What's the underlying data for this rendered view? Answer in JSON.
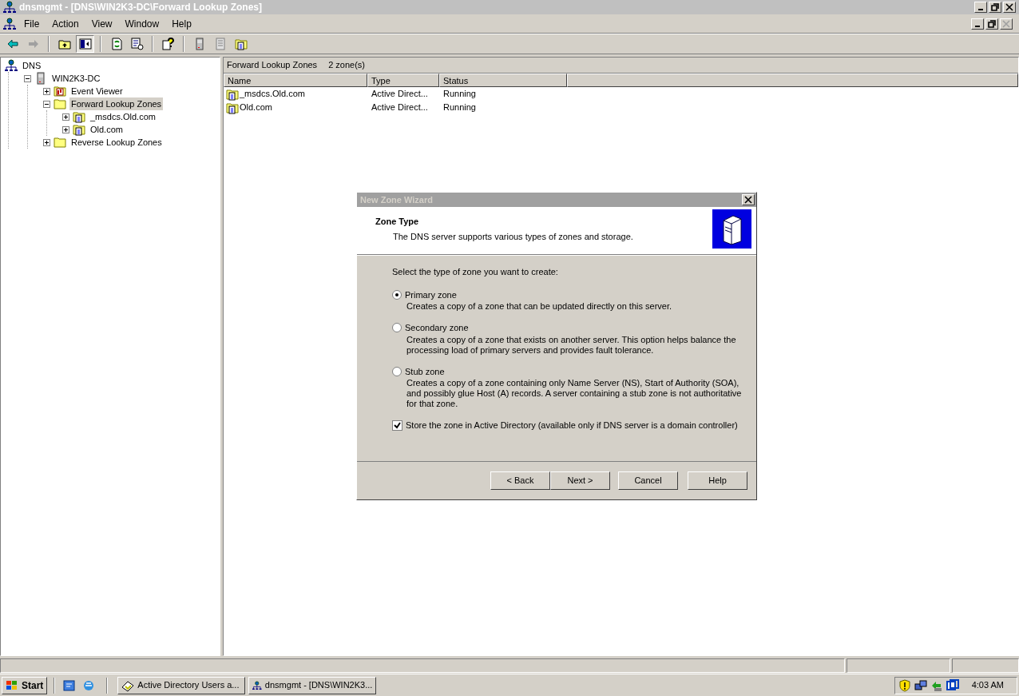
{
  "window": {
    "title": "dnsmgmt - [DNS\\WIN2K3-DC\\Forward Lookup Zones]",
    "active": false
  },
  "menu": [
    "File",
    "Action",
    "View",
    "Window",
    "Help"
  ],
  "toolbar": [
    {
      "kind": "back",
      "pressed": false
    },
    {
      "kind": "forward",
      "pressed": false
    },
    {
      "kind": "up",
      "pressed": false
    },
    {
      "kind": "tree",
      "pressed": true
    },
    {
      "kind": "refresh",
      "pressed": false
    },
    {
      "kind": "export",
      "pressed": false
    },
    {
      "kind": "help",
      "pressed": false
    },
    {
      "kind": "server",
      "pressed": false
    },
    {
      "kind": "list",
      "pressed": false
    },
    {
      "kind": "zone",
      "pressed": false
    }
  ],
  "tree": [
    {
      "label": "DNS",
      "kind": "dns",
      "selected": false,
      "children": [
        {
          "label": "WIN2K3-DC",
          "kind": "server",
          "expanded": true,
          "selected": false,
          "children": [
            {
              "label": "Event Viewer",
              "kind": "event",
              "expanded": false,
              "selected": false
            },
            {
              "label": "Forward Lookup Zones",
              "kind": "folder",
              "expanded": true,
              "selected": true,
              "children": [
                {
                  "label": "_msdcs.Old.com",
                  "kind": "zone",
                  "expanded": false,
                  "selected": false
                },
                {
                  "label": "Old.com",
                  "kind": "zone",
                  "expanded": false,
                  "selected": false
                }
              ]
            },
            {
              "label": "Reverse Lookup Zones",
              "kind": "folder",
              "expanded": false,
              "selected": false
            }
          ]
        }
      ]
    }
  ],
  "pane": {
    "title": "Forward Lookup Zones",
    "count": "2 zone(s)",
    "columns": [
      "Name",
      "Type",
      "Status"
    ],
    "rows": [
      {
        "name": "_msdcs.Old.com",
        "type": "Active Direct...",
        "status": "Running"
      },
      {
        "name": "Old.com",
        "type": "Active Direct...",
        "status": "Running"
      }
    ]
  },
  "dialog": {
    "title": "New Zone Wizard",
    "heading": "Zone Type",
    "subtitle": "The DNS server supports various types of zones and storage.",
    "prompt": "Select the type of zone you want to create:",
    "options": [
      {
        "label": "Primary zone",
        "description": "Creates a copy of a zone that can be updated directly on this server.",
        "selected": true
      },
      {
        "label": "Secondary zone",
        "description": "Creates a copy of a zone that exists on another server. This option helps balance the processing load of primary servers and provides fault tolerance.",
        "selected": false
      },
      {
        "label": "Stub zone",
        "description": "Creates a copy of a zone containing only Name Server (NS), Start of Authority (SOA), and possibly glue Host (A) records. A server containing a stub zone is not authoritative for that zone.",
        "selected": false
      }
    ],
    "checkbox": {
      "label": "Store the zone in Active Directory (available only if DNS server is a domain controller)",
      "checked": true
    },
    "buttons": [
      "< Back",
      "Next >",
      "Cancel",
      "Help"
    ]
  },
  "taskbar": {
    "start": "Start",
    "tasks": [
      {
        "label": "Active Directory Users a...",
        "kind": "ad",
        "selected": false
      },
      {
        "label": "dnsmgmt - [DNS\\WIN2K3...",
        "kind": "dns",
        "selected": false
      }
    ],
    "time": "4:03 AM"
  }
}
